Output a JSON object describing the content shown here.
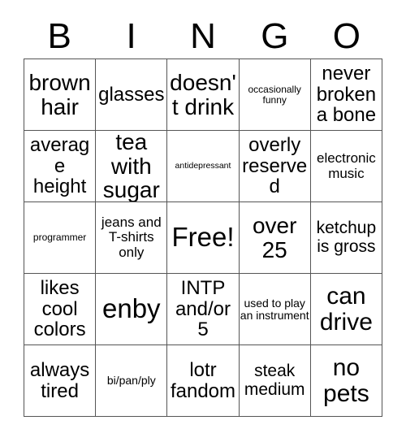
{
  "card": {
    "title": "BINGO",
    "header_letters": [
      "B",
      "I",
      "N",
      "G",
      "O"
    ],
    "colors": {
      "background": "#ffffff",
      "text": "#000000",
      "border": "#555555"
    },
    "grid": {
      "rows": 5,
      "columns": 5,
      "free_space": "Free!",
      "free_space_position": "row3-col3"
    },
    "cells": [
      {
        "id": "b1",
        "text": "brown hair",
        "size": "s-l"
      },
      {
        "id": "i1",
        "text": "glasses",
        "size": "s-m"
      },
      {
        "id": "n1",
        "text": "doesn't drink",
        "size": "s-l"
      },
      {
        "id": "g1",
        "text": "occasionally funny",
        "size": "s-t"
      },
      {
        "id": "o1",
        "text": "never broken a bone",
        "size": "s-m"
      },
      {
        "id": "b2",
        "text": "average height",
        "size": "s-m"
      },
      {
        "id": "i2",
        "text": "tea with sugar",
        "size": "s-l"
      },
      {
        "id": "n2",
        "text": "antidepressant",
        "size": "s-tt"
      },
      {
        "id": "g2",
        "text": "overly reserved",
        "size": "s-m"
      },
      {
        "id": "o2",
        "text": "electronic music",
        "size": "s-xs"
      },
      {
        "id": "b3",
        "text": "programmer",
        "size": "s-t"
      },
      {
        "id": "i3",
        "text": "jeans and T-shirts only",
        "size": "s-xs"
      },
      {
        "id": "n3",
        "text": "Free!",
        "size": "s-xxl"
      },
      {
        "id": "g3",
        "text": "over 25",
        "size": "s-l"
      },
      {
        "id": "o3",
        "text": "ketchup is gross",
        "size": "s-s"
      },
      {
        "id": "b4",
        "text": "likes cool colors",
        "size": "s-m"
      },
      {
        "id": "i4",
        "text": "enby",
        "size": "s-xxl"
      },
      {
        "id": "n4",
        "text": "INTP and/or 5",
        "size": "s-m"
      },
      {
        "id": "g4",
        "text": "used to play an instrument",
        "size": "s-xxs"
      },
      {
        "id": "o4",
        "text": "can drive",
        "size": "s-xl"
      },
      {
        "id": "b5",
        "text": "always tired",
        "size": "s-m"
      },
      {
        "id": "i5",
        "text": "bi/pan/ply",
        "size": "s-xxs"
      },
      {
        "id": "n5",
        "text": "lotr fandom",
        "size": "s-m"
      },
      {
        "id": "g5",
        "text": "steak medium",
        "size": "s-s"
      },
      {
        "id": "o5",
        "text": "no pets",
        "size": "s-xl"
      }
    ]
  }
}
